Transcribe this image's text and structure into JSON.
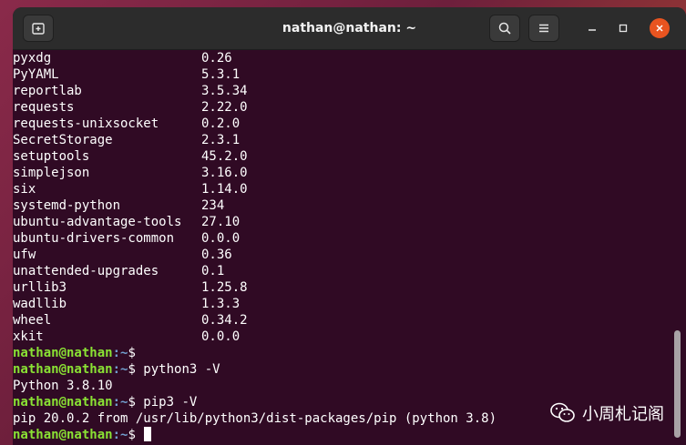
{
  "window": {
    "title": "nathan@nathan: ~"
  },
  "packages": [
    {
      "name": "pyxdg",
      "version": "0.26"
    },
    {
      "name": "PyYAML",
      "version": "5.3.1"
    },
    {
      "name": "reportlab",
      "version": "3.5.34"
    },
    {
      "name": "requests",
      "version": "2.22.0"
    },
    {
      "name": "requests-unixsocket",
      "version": "0.2.0"
    },
    {
      "name": "SecretStorage",
      "version": "2.3.1"
    },
    {
      "name": "setuptools",
      "version": "45.2.0"
    },
    {
      "name": "simplejson",
      "version": "3.16.0"
    },
    {
      "name": "six",
      "version": "1.14.0"
    },
    {
      "name": "systemd-python",
      "version": "234"
    },
    {
      "name": "ubuntu-advantage-tools",
      "version": "27.10"
    },
    {
      "name": "ubuntu-drivers-common",
      "version": "0.0.0"
    },
    {
      "name": "ufw",
      "version": "0.36"
    },
    {
      "name": "unattended-upgrades",
      "version": "0.1"
    },
    {
      "name": "urllib3",
      "version": "1.25.8"
    },
    {
      "name": "wadllib",
      "version": "1.3.3"
    },
    {
      "name": "wheel",
      "version": "0.34.2"
    },
    {
      "name": "xkit",
      "version": "0.0.0"
    }
  ],
  "session": [
    {
      "user": "nathan@nathan",
      "path": ":~",
      "symbol": "$",
      "command": ""
    },
    {
      "user": "nathan@nathan",
      "path": ":~",
      "symbol": "$",
      "command": " python3 -V"
    },
    {
      "output": "Python 3.8.10"
    },
    {
      "user": "nathan@nathan",
      "path": ":~",
      "symbol": "$",
      "command": " pip3 -V"
    },
    {
      "output": "pip 20.0.2 from /usr/lib/python3/dist-packages/pip (python 3.8)"
    },
    {
      "user": "nathan@nathan",
      "path": ":~",
      "symbol": "$",
      "command": " "
    }
  ],
  "watermark": {
    "text": "小周札记阁"
  },
  "icons": {
    "new_tab": "new-tab-icon",
    "search": "search-icon",
    "menu": "hamburger-menu-icon",
    "minimize": "minimize-icon",
    "maximize": "maximize-icon",
    "close": "close-icon",
    "watermark": "wechat-icon"
  },
  "colors": {
    "terminal_bg": "#300a24",
    "prompt_user": "#8ae234",
    "prompt_path": "#729fcf",
    "close_button": "#e95420"
  }
}
